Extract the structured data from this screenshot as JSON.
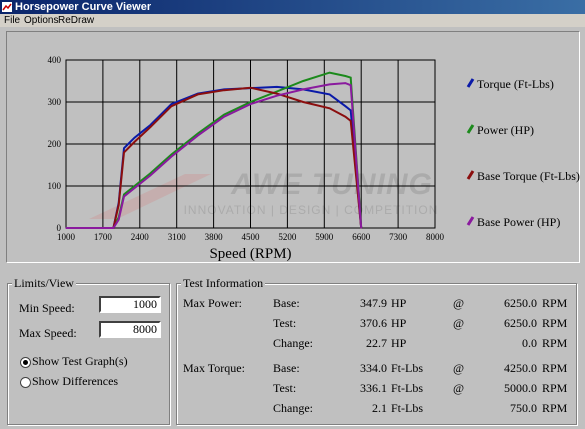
{
  "window": {
    "title": "Horsepower Curve Viewer"
  },
  "menu": {
    "items": [
      "File",
      "Options",
      "ReDraw"
    ]
  },
  "chart_data": {
    "type": "line",
    "xlabel": "Speed (RPM)",
    "ylabel": "",
    "xlim": [
      1000,
      8000
    ],
    "ylim": [
      0,
      400
    ],
    "x_ticks": [
      "1000",
      "1700",
      "2400",
      "3100",
      "3800",
      "4500",
      "5200",
      "5900",
      "6600",
      "7300",
      "8000"
    ],
    "y_ticks": [
      "0",
      "100",
      "200",
      "300",
      "400"
    ],
    "grid": true,
    "legend_position": "right",
    "watermark": "AWE TUNING",
    "watermark_sub": "INNOVATION | DESIGN | COMPETITION",
    "series": [
      {
        "name": "Torque (Ft-Lbs)",
        "color": "#0a1aa8",
        "x": [
          1000,
          1900,
          2000,
          2100,
          2300,
          2600,
          3000,
          3500,
          4000,
          4500,
          5000,
          5500,
          6000,
          6300,
          6400,
          6600
        ],
        "y": [
          0,
          0,
          60,
          190,
          215,
          245,
          295,
          320,
          330,
          333,
          336,
          330,
          318,
          290,
          280,
          0
        ]
      },
      {
        "name": "Power (HP)",
        "color": "#1c8a1c",
        "x": [
          1000,
          1900,
          2000,
          2100,
          2300,
          2600,
          3000,
          3500,
          4000,
          4500,
          5000,
          5500,
          6000,
          6300,
          6400,
          6600
        ],
        "y": [
          0,
          0,
          25,
          80,
          100,
          130,
          175,
          225,
          270,
          300,
          325,
          350,
          370,
          362,
          358,
          0
        ]
      },
      {
        "name": "Base Torque (Ft-Lbs)",
        "color": "#8b0e0e",
        "x": [
          1000,
          1900,
          2000,
          2100,
          2300,
          2600,
          3000,
          3500,
          4000,
          4500,
          5000,
          5500,
          6000,
          6300,
          6400,
          6600
        ],
        "y": [
          0,
          0,
          55,
          180,
          205,
          240,
          290,
          318,
          328,
          334,
          320,
          300,
          285,
          265,
          255,
          0
        ]
      },
      {
        "name": "Base Power (HP)",
        "color": "#8a1a9e",
        "x": [
          1000,
          1900,
          2000,
          2100,
          2300,
          2600,
          3000,
          3500,
          4000,
          4500,
          5000,
          5500,
          6000,
          6300,
          6400,
          6600
        ],
        "y": [
          0,
          0,
          20,
          75,
          95,
          125,
          170,
          220,
          265,
          295,
          315,
          330,
          342,
          345,
          340,
          0
        ]
      }
    ]
  },
  "limits": {
    "title": "Limits/View",
    "min_label": "Min Speed:",
    "min_value": "1000",
    "max_label": "Max Speed:",
    "max_value": "8000",
    "radio_test": "Show Test Graph(s)",
    "radio_diff": "Show Differences",
    "selected": "test"
  },
  "test_info": {
    "title": "Test Information",
    "power_label": "Max Power:",
    "torque_label": "Max Torque:",
    "power_rows": [
      {
        "label": "Base:",
        "value": "347.9",
        "unit": "HP",
        "at": "@",
        "rpm": "6250.0",
        "rpm_unit": "RPM"
      },
      {
        "label": "Test:",
        "value": "370.6",
        "unit": "HP",
        "at": "@",
        "rpm": "6250.0",
        "rpm_unit": "RPM"
      },
      {
        "label": "Change:",
        "value": "22.7",
        "unit": "HP",
        "at": "",
        "rpm": "0.0",
        "rpm_unit": "RPM"
      }
    ],
    "torque_rows": [
      {
        "label": "Base:",
        "value": "334.0",
        "unit": "Ft-Lbs",
        "at": "@",
        "rpm": "4250.0",
        "rpm_unit": "RPM"
      },
      {
        "label": "Test:",
        "value": "336.1",
        "unit": "Ft-Lbs",
        "at": "@",
        "rpm": "5000.0",
        "rpm_unit": "RPM"
      },
      {
        "label": "Change:",
        "value": "2.1",
        "unit": "Ft-Lbs",
        "at": "",
        "rpm": "750.0",
        "rpm_unit": "RPM"
      }
    ]
  }
}
